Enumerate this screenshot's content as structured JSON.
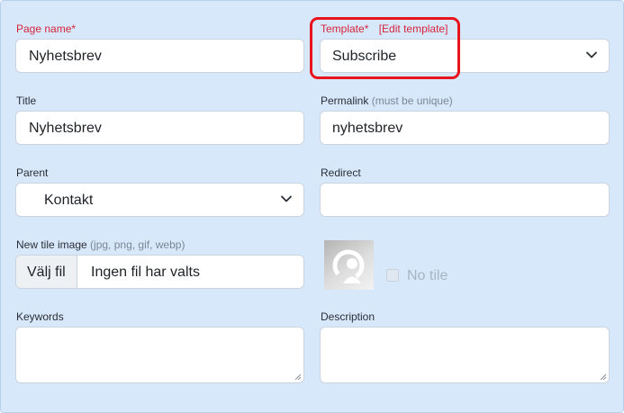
{
  "page_name": {
    "label": "Page name*",
    "value": "Nyhetsbrev"
  },
  "template": {
    "label": "Template*",
    "edit_link": "[Edit template]",
    "value": "Subscribe",
    "icon": "chevron-down-icon"
  },
  "title": {
    "label": "Title",
    "value": "Nyhetsbrev"
  },
  "permalink": {
    "label": "Permalink",
    "hint": "(must be unique)",
    "value": "nyhetsbrev"
  },
  "parent": {
    "label": "Parent",
    "value": "Kontakt",
    "icon": "chevron-down-icon"
  },
  "redirect": {
    "label": "Redirect",
    "value": ""
  },
  "tile_image": {
    "label": "New tile image",
    "hint": "(jpg, png, gif, webp)",
    "button_label": "Välj fil",
    "file_status": "Ingen fil har valts"
  },
  "no_tile": {
    "label": "No tile",
    "checked": false
  },
  "keywords": {
    "label": "Keywords",
    "value": ""
  },
  "description": {
    "label": "Description",
    "value": ""
  },
  "colors": {
    "panel_bg": "#d8e8fb",
    "required_label": "#d4253b",
    "highlight": "#e8141e"
  }
}
